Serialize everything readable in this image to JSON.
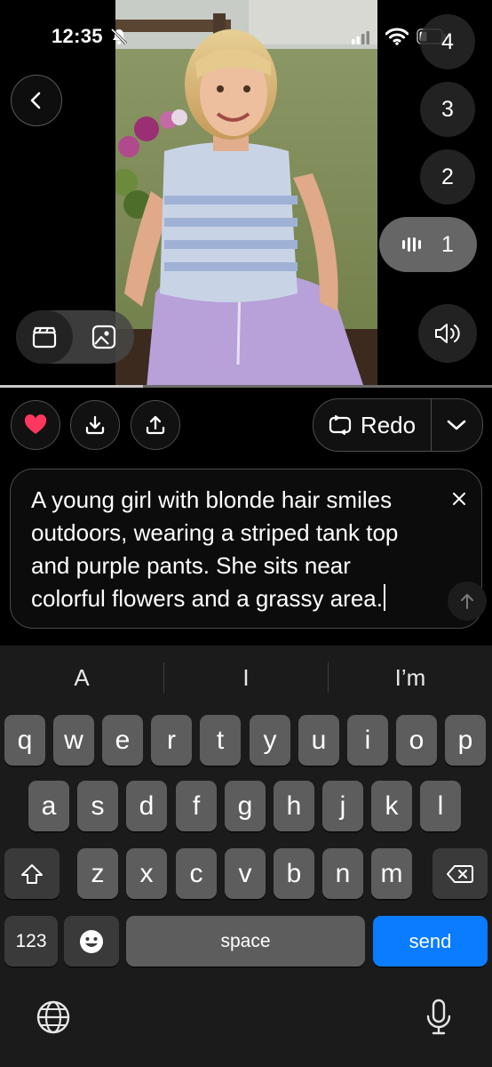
{
  "status_bar": {
    "time": "12:35"
  },
  "media": {
    "counts": [
      "4",
      "3",
      "2",
      "1"
    ],
    "selected_count": "1",
    "progress_fraction": 0.29
  },
  "actions": {
    "redo_label": "Redo"
  },
  "prompt": {
    "text": "A young girl with blonde hair smiles outdoors, wearing a striped tank top and purple pants. She sits near colorful flowers and a grassy area."
  },
  "keyboard": {
    "suggestions": [
      "A",
      "I",
      "I’m"
    ],
    "row1": [
      "q",
      "w",
      "e",
      "r",
      "t",
      "y",
      "u",
      "i",
      "o",
      "p"
    ],
    "row2": [
      "a",
      "s",
      "d",
      "f",
      "g",
      "h",
      "j",
      "k",
      "l"
    ],
    "row3": [
      "z",
      "x",
      "c",
      "v",
      "b",
      "n",
      "m"
    ],
    "numbers_label": "123",
    "space_label": "space",
    "send_label": "send"
  },
  "colors": {
    "like": "#ff375f",
    "send": "#0a7cff"
  },
  "icons": [
    "bell-slash-icon",
    "signal-icon",
    "wifi-icon",
    "battery-icon",
    "back-icon",
    "waveform-icon",
    "speaker-icon",
    "video-clapper-icon",
    "image-icon",
    "heart-icon",
    "download-icon",
    "share-icon",
    "repeat-icon",
    "chevron-down-icon",
    "close-icon",
    "arrow-up-icon",
    "shift-icon",
    "delete-icon",
    "emoji-icon",
    "globe-icon",
    "microphone-icon"
  ]
}
